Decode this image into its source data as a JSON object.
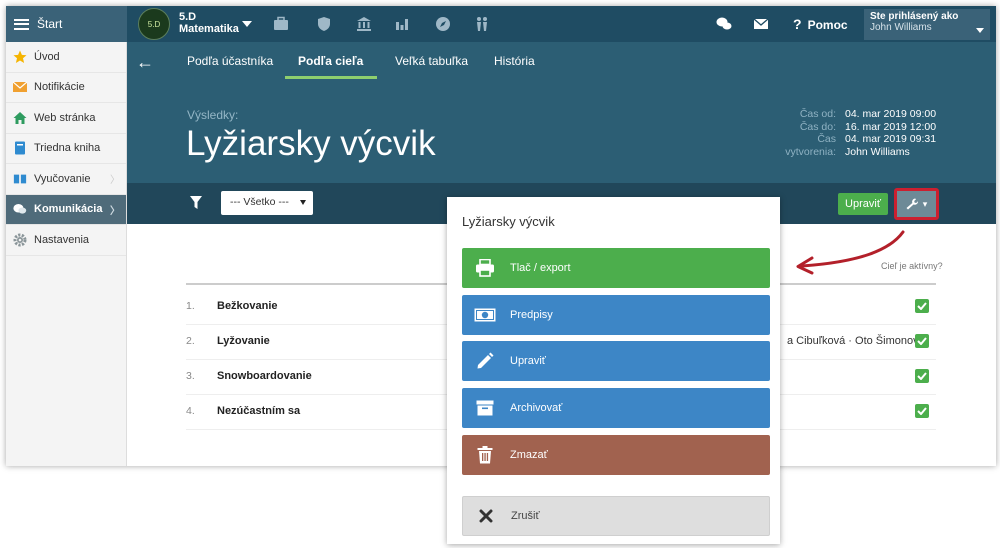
{
  "topbar": {
    "start_label": "Štart",
    "class_badge": "5.D",
    "class_name": "5.D",
    "class_subject": "Matematika",
    "help_label": "Pomoc",
    "help_symbol": "?",
    "user_title": "Ste prihlásený ako",
    "user_name": "John Williams",
    "icons": [
      "briefcase-icon",
      "shield-icon",
      "building-icon",
      "bar-chart-icon",
      "compass-icon",
      "people-icon",
      "chat-icon",
      "mail-icon"
    ]
  },
  "sidebar": {
    "items": [
      {
        "label": "Úvod",
        "icon": "star-icon"
      },
      {
        "label": "Notifikácie",
        "icon": "envelope-icon"
      },
      {
        "label": "Web stránka",
        "icon": "home-icon"
      },
      {
        "label": "Triedna kniha",
        "icon": "book-icon"
      },
      {
        "label": "Vyučovanie",
        "icon": "open-book-icon"
      },
      {
        "label": "Komunikácia",
        "icon": "chat-bubbles-icon"
      },
      {
        "label": "Nastavenia",
        "icon": "gear-icon"
      }
    ]
  },
  "header": {
    "tabs": [
      "Podľa účastníka",
      "Podľa cieľa",
      "Veľká tabuľka",
      "História"
    ],
    "active_tab": "Podľa cieľa",
    "subtitle": "Výsledky:",
    "title": "Lyžiarsky výcvik",
    "meta_labels": {
      "from": "Čas od:",
      "to": "Čas do:",
      "created_1": "Čas",
      "created_2": "vytvorenia:"
    },
    "meta_values": {
      "from": "04. mar 2019 09:00",
      "to": "16. mar 2019 12:00",
      "created": "04. mar 2019 09:31",
      "author": "John Williams"
    }
  },
  "filterbar": {
    "select_value": "--- Všetko ---",
    "edit_label": "Upraviť"
  },
  "content": {
    "active_header": "Cieľ je aktívny?",
    "rows": [
      {
        "num": "1.",
        "name": "Bežkovanie",
        "people": ""
      },
      {
        "num": "2.",
        "name": "Lyžovanie",
        "people": "a Cibuľková · Oto Šimonovič"
      },
      {
        "num": "3.",
        "name": "Snowboardovanie",
        "people": ""
      },
      {
        "num": "4.",
        "name": "Nezúčastním sa",
        "people": ""
      }
    ]
  },
  "panel": {
    "title": "Lyžiarsky výcvik",
    "buttons": {
      "print": "Tlač / export",
      "rules": "Predpisy",
      "edit": "Upraviť",
      "archive": "Archivovať",
      "delete": "Zmazať",
      "cancel": "Zrušiť"
    }
  },
  "colors": {
    "topbar": "#1f4c63",
    "header": "#2c5e74",
    "filterbar": "#21475a",
    "green": "#4cae4c",
    "blue": "#3d86c6",
    "brown": "#a1624f",
    "highlight_red": "#cc1f2f"
  }
}
